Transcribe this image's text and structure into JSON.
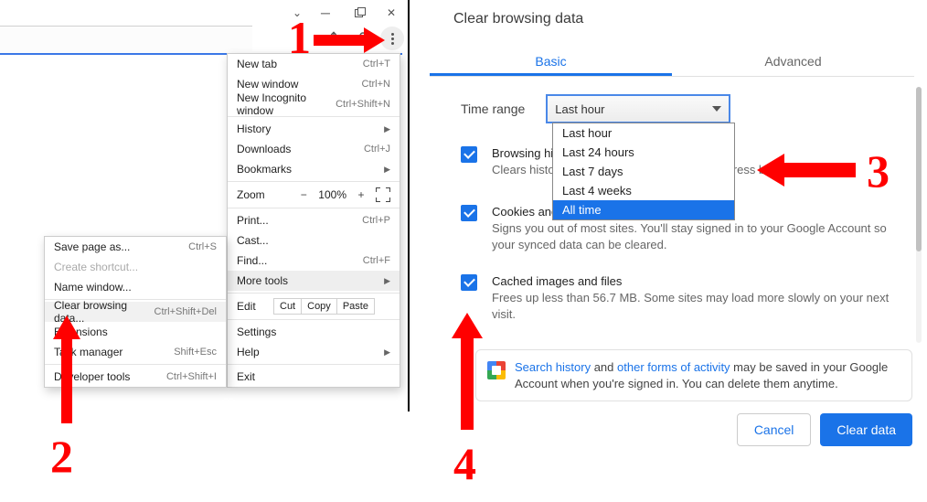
{
  "window": {
    "controls": {
      "dropdown": "v",
      "minimize": "—",
      "maximize": "▢",
      "close": "✕"
    },
    "toolbar": {
      "share": "share-icon",
      "profile": "profile-icon",
      "kebab": "more-icon"
    }
  },
  "menu": {
    "new_tab": {
      "label": "New tab",
      "short": "Ctrl+T"
    },
    "new_window": {
      "label": "New window",
      "short": "Ctrl+N"
    },
    "incognito": {
      "label": "New Incognito window",
      "short": "Ctrl+Shift+N"
    },
    "history": {
      "label": "History"
    },
    "downloads": {
      "label": "Downloads",
      "short": "Ctrl+J"
    },
    "bookmarks": {
      "label": "Bookmarks"
    },
    "zoom": {
      "label": "Zoom",
      "minus": "−",
      "pct": "100%",
      "plus": "+"
    },
    "print": {
      "label": "Print...",
      "short": "Ctrl+P"
    },
    "cast": {
      "label": "Cast..."
    },
    "find": {
      "label": "Find...",
      "short": "Ctrl+F"
    },
    "more_tools": {
      "label": "More tools"
    },
    "edit": {
      "label": "Edit",
      "cut": "Cut",
      "copy": "Copy",
      "paste": "Paste"
    },
    "settings": {
      "label": "Settings"
    },
    "help": {
      "label": "Help"
    },
    "exit": {
      "label": "Exit"
    }
  },
  "submenu": {
    "save_as": {
      "label": "Save page as...",
      "short": "Ctrl+S"
    },
    "create_shortcut": {
      "label": "Create shortcut..."
    },
    "name_window": {
      "label": "Name window..."
    },
    "clear_data": {
      "label": "Clear browsing data...",
      "short": "Ctrl+Shift+Del"
    },
    "extensions": {
      "label": "Extensions"
    },
    "task_manager": {
      "label": "Task manager",
      "short": "Shift+Esc"
    },
    "dev_tools": {
      "label": "Developer tools",
      "short": "Ctrl+Shift+I"
    }
  },
  "dialog": {
    "title": "Clear browsing data",
    "tabs": {
      "basic": "Basic",
      "advanced": "Advanced"
    },
    "time_label": "Time range",
    "time_value": "Last hour",
    "time_options": [
      "Last hour",
      "Last 24 hours",
      "Last 7 days",
      "Last 4 weeks",
      "All time"
    ],
    "cb1": {
      "title": "Browsing history",
      "desc": "Clears history and autocompletions in the address bar."
    },
    "cb2": {
      "title": "Cookies and other site data",
      "desc": "Signs you out of most sites. You'll stay signed in to your Google Account so your synced data can be cleared."
    },
    "cb3": {
      "title": "Cached images and files",
      "desc": "Frees up less than 56.7 MB. Some sites may load more slowly on your next visit."
    },
    "info": {
      "link1": "Search history",
      "mid": " and ",
      "link2": "other forms of activity",
      "rest": " may be saved in your Google Account when you're signed in. You can delete them anytime."
    },
    "cancel": "Cancel",
    "clear": "Clear data"
  },
  "anno": {
    "n1": "1",
    "n2": "2",
    "n3": "3",
    "n4": "4"
  }
}
